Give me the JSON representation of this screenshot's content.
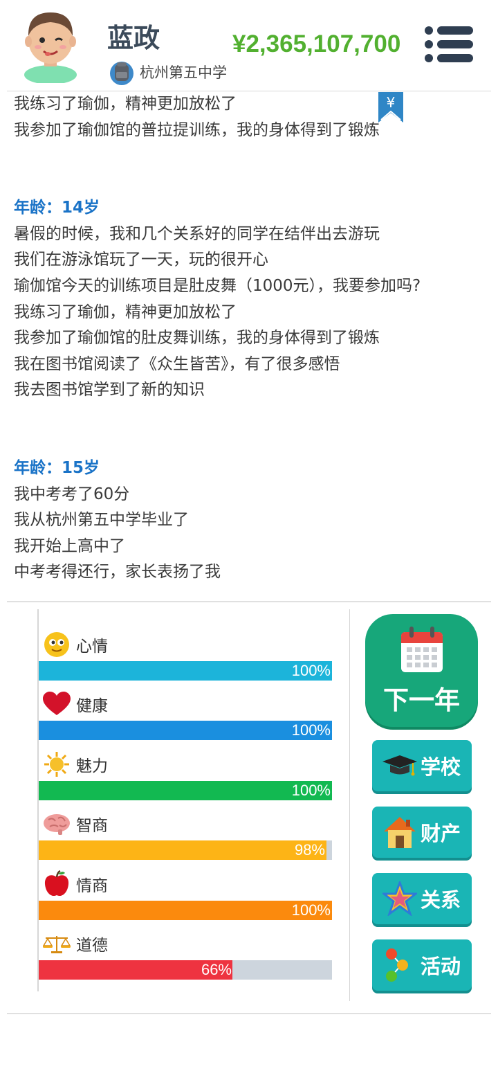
{
  "player": {
    "name": "蓝政",
    "school": "杭州第五中学",
    "money": "¥2,365,107,700"
  },
  "bookmark_symbol": "¥",
  "log": {
    "intro_lines": [
      "我练习了瑜伽，精神更加放松了",
      "我参加了瑜伽馆的普拉提训练，我的身体得到了锻炼"
    ],
    "year14": {
      "age": "年龄：14岁",
      "lines": [
        "暑假的时候，我和几个关系好的同学在结伴出去游玩",
        "我们在游泳馆玩了一天，玩的很开心",
        "瑜伽馆今天的训练项目是肚皮舞（1000元），我要参加吗?",
        "我练习了瑜伽，精神更加放松了",
        "我参加了瑜伽馆的肚皮舞训练，我的身体得到了锻炼",
        "我在图书馆阅读了《众生皆苦》，有了很多感悟",
        "我去图书馆学到了新的知识"
      ]
    },
    "year15": {
      "age": "年龄：15岁",
      "lines": [
        "我中考考了60分",
        "我从杭州第五中学毕业了",
        "我开始上高中了",
        "中考考得还行，家长表扬了我"
      ]
    }
  },
  "stats": [
    {
      "name": "心情",
      "value": 100,
      "display": "100%",
      "color": "#1cb4da",
      "icon": "smiley-icon"
    },
    {
      "name": "健康",
      "value": 100,
      "display": "100%",
      "color": "#1a8fdf",
      "icon": "heart-icon"
    },
    {
      "name": "魅力",
      "value": 100,
      "display": "100%",
      "color": "#12b951",
      "icon": "sun-icon"
    },
    {
      "name": "智商",
      "value": 98,
      "display": "98%",
      "color": "#fdb416",
      "icon": "brain-icon"
    },
    {
      "name": "情商",
      "value": 100,
      "display": "100%",
      "color": "#fb8a0d",
      "icon": "apple-icon"
    },
    {
      "name": "道德",
      "value": 66,
      "display": "66%",
      "color": "#ee3340",
      "icon": "scale-icon"
    }
  ],
  "buttons": {
    "next_year": "下一年",
    "school": "学校",
    "property": "财产",
    "relations": "关系",
    "activities": "活动"
  }
}
